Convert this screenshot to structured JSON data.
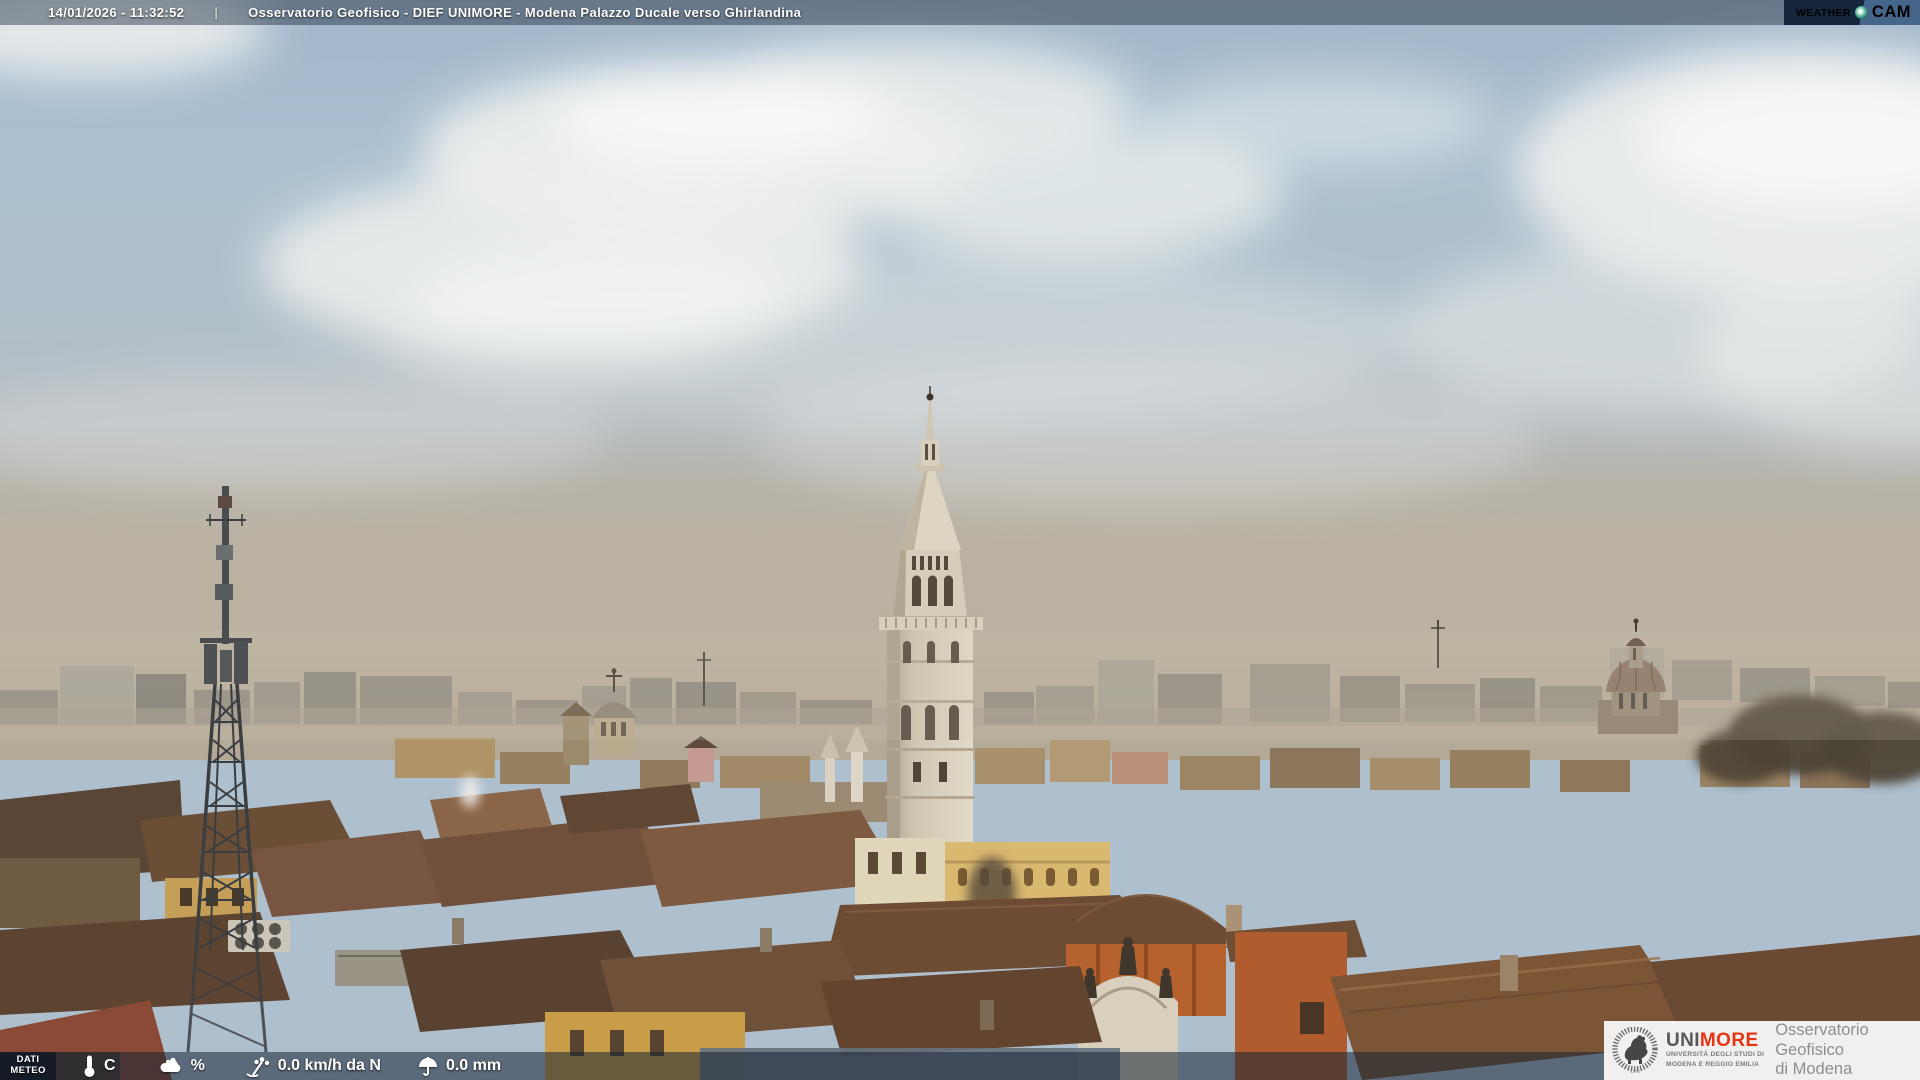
{
  "header": {
    "datetime": "14/01/2026 - 11:32:52",
    "separator": "|",
    "title": "Osservatorio Geofisico - DIEF UNIMORE - Modena Palazzo Ducale verso Ghirlandina"
  },
  "watermark": {
    "brand_part1": "WEATHER",
    "brand_part2": "CAM",
    "globe_icon": "globe-icon"
  },
  "meteo_bar": {
    "label_line1": "DATI",
    "label_line2": "METEO",
    "temperature": {
      "unit": "C",
      "icon": "thermometer-icon"
    },
    "humidity": {
      "unit": "%",
      "icon": "humidity-cloud-icon"
    },
    "wind": {
      "text": "0.0 km/h da N",
      "icon": "anemometer-icon"
    },
    "rain": {
      "text": "0.0 mm",
      "icon": "umbrella-icon"
    }
  },
  "branding_box": {
    "seal_icon": "unimore-seal-icon",
    "wordmark_part1": "UNI",
    "wordmark_part2": "MORE",
    "university_line1": "UNIVERSITÀ DEGLI STUDI DI",
    "university_line2": "MODENA E REGGIO EMILIA",
    "org_line1": "Osservatorio Geofisico",
    "org_line2": "di Modena"
  },
  "colors": {
    "unimore_red": "#e63312",
    "wordmark_gray": "#57575b",
    "overlay_bar": "rgba(24,36,52,0.55)",
    "weathercam_navy": "#15253c",
    "weathercam_steel": "#45658a",
    "weathercam_teal": "#2e8b7d",
    "sky_blue": "#aabfd1",
    "haze_warm": "#b9b1a2",
    "roof_terracotta": "#7b5536"
  },
  "scene": {
    "description": "Daytime webcam view over Modena rooftops from Palazzo Ducale toward the Ghirlandina tower, hazy horizon with modern blocks, telecom lattice mast at left, church dome at right",
    "landmarks": [
      "ghirlandina-tower",
      "telecom-antenna-mast",
      "church-dome",
      "cathedral-pinnacles",
      "terracotta-rooftops",
      "hazy-skyline",
      "cumulus-clouds"
    ]
  }
}
